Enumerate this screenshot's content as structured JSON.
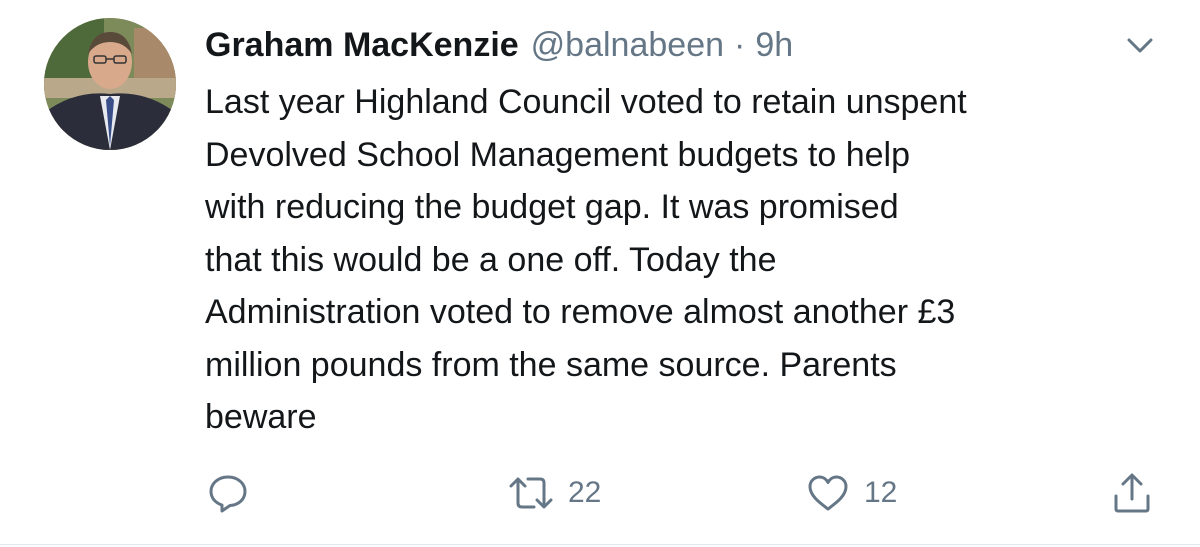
{
  "tweet": {
    "author": {
      "name": "Graham MacKenzie",
      "handle": "@balnabeen"
    },
    "separator": "·",
    "time": "9h",
    "text_lines": [
      "Last year Highland Council voted to retain unspent",
      "Devolved School Management budgets to help",
      "with reducing the budget gap. It was promised",
      "that this would be a one off. Today the",
      "Administration voted to remove almost another £3",
      "million pounds from the same source. Parents",
      "beware"
    ],
    "actions": {
      "reply": {
        "icon": "reply-icon",
        "count": ""
      },
      "retweet": {
        "icon": "retweet-icon",
        "count": "22"
      },
      "like": {
        "icon": "heart-icon",
        "count": "12"
      },
      "share": {
        "icon": "share-icon"
      }
    },
    "menu_icon": "chevron-down-icon"
  },
  "colors": {
    "text": "#14171a",
    "secondary": "#657786",
    "divider": "#e1e8ed",
    "background": "#ffffff"
  }
}
